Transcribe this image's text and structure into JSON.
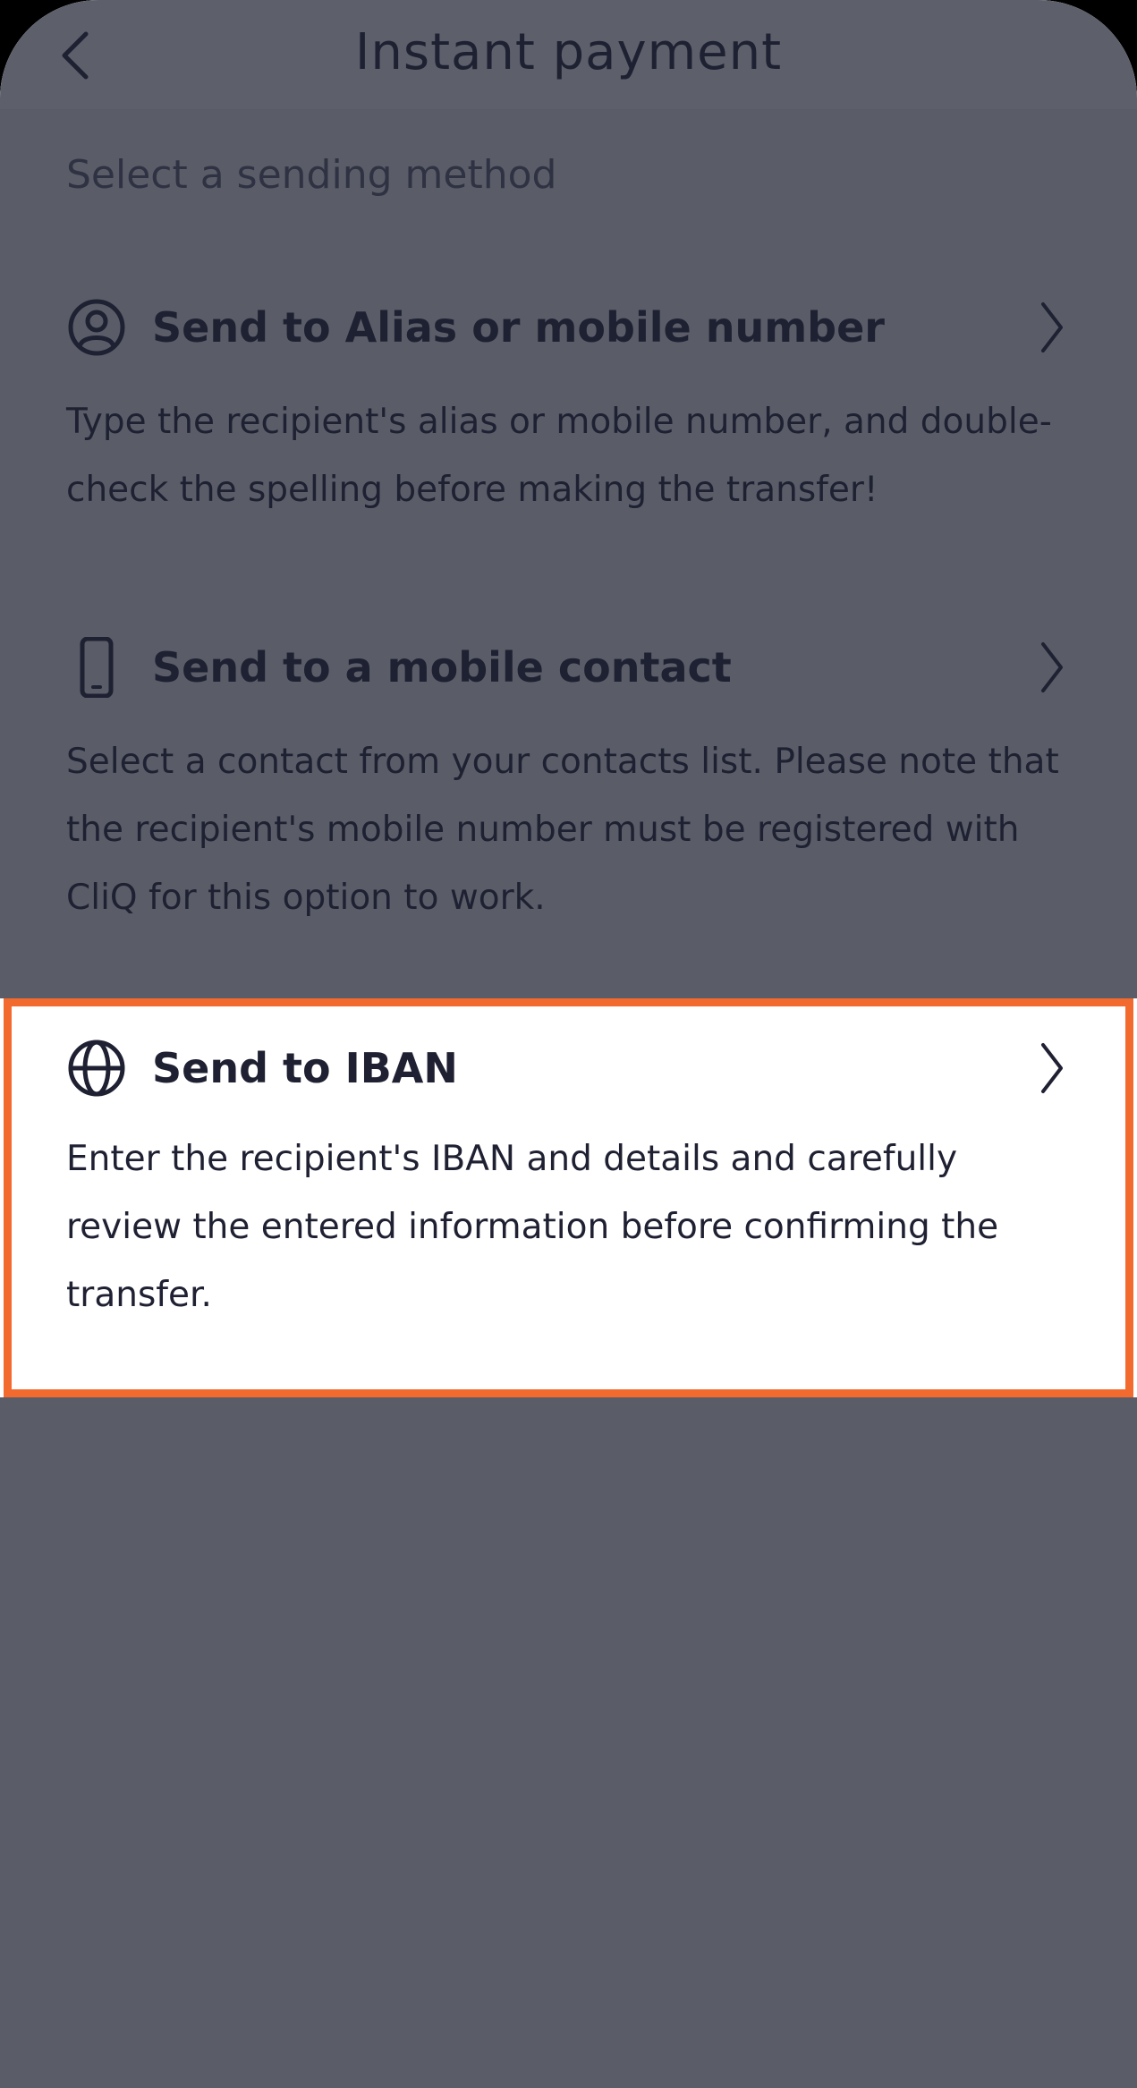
{
  "header": {
    "title": "Instant payment",
    "back_icon": "chevron-left-icon"
  },
  "section_label": "Select a sending method",
  "options": [
    {
      "icon": "user-circle-icon",
      "title": "Send to Alias or mobile number",
      "description": "Type the recipient's alias or mobile number, and double-check the spelling before making the transfer!"
    },
    {
      "icon": "smartphone-icon",
      "title": "Send to a mobile contact",
      "description": "Select a contact from your contacts list. Please note that the recipient's mobile number must be registered with CliQ for this option to work."
    },
    {
      "icon": "globe-icon",
      "title": "Send to IBAN",
      "description": "Enter the recipient's IBAN and details and carefully review the entered information before confirming the transfer."
    }
  ],
  "colors": {
    "highlight": "#f26a2e",
    "overlay": "rgba(30,33,50,0.72)",
    "text": "#1f2133"
  }
}
